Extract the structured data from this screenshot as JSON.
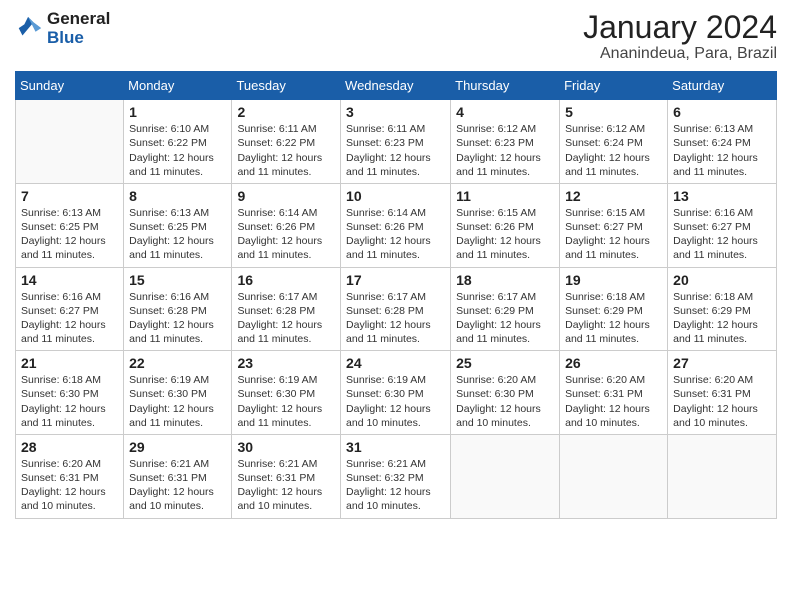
{
  "header": {
    "logo_line1": "General",
    "logo_line2": "Blue",
    "month": "January 2024",
    "location": "Ananindeua, Para, Brazil"
  },
  "weekdays": [
    "Sunday",
    "Monday",
    "Tuesday",
    "Wednesday",
    "Thursday",
    "Friday",
    "Saturday"
  ],
  "weeks": [
    [
      {
        "day": "",
        "sunrise": "",
        "sunset": "",
        "daylight": ""
      },
      {
        "day": "1",
        "sunrise": "Sunrise: 6:10 AM",
        "sunset": "Sunset: 6:22 PM",
        "daylight": "Daylight: 12 hours and 11 minutes."
      },
      {
        "day": "2",
        "sunrise": "Sunrise: 6:11 AM",
        "sunset": "Sunset: 6:22 PM",
        "daylight": "Daylight: 12 hours and 11 minutes."
      },
      {
        "day": "3",
        "sunrise": "Sunrise: 6:11 AM",
        "sunset": "Sunset: 6:23 PM",
        "daylight": "Daylight: 12 hours and 11 minutes."
      },
      {
        "day": "4",
        "sunrise": "Sunrise: 6:12 AM",
        "sunset": "Sunset: 6:23 PM",
        "daylight": "Daylight: 12 hours and 11 minutes."
      },
      {
        "day": "5",
        "sunrise": "Sunrise: 6:12 AM",
        "sunset": "Sunset: 6:24 PM",
        "daylight": "Daylight: 12 hours and 11 minutes."
      },
      {
        "day": "6",
        "sunrise": "Sunrise: 6:13 AM",
        "sunset": "Sunset: 6:24 PM",
        "daylight": "Daylight: 12 hours and 11 minutes."
      }
    ],
    [
      {
        "day": "7",
        "sunrise": "Sunrise: 6:13 AM",
        "sunset": "Sunset: 6:25 PM",
        "daylight": "Daylight: 12 hours and 11 minutes."
      },
      {
        "day": "8",
        "sunrise": "Sunrise: 6:13 AM",
        "sunset": "Sunset: 6:25 PM",
        "daylight": "Daylight: 12 hours and 11 minutes."
      },
      {
        "day": "9",
        "sunrise": "Sunrise: 6:14 AM",
        "sunset": "Sunset: 6:26 PM",
        "daylight": "Daylight: 12 hours and 11 minutes."
      },
      {
        "day": "10",
        "sunrise": "Sunrise: 6:14 AM",
        "sunset": "Sunset: 6:26 PM",
        "daylight": "Daylight: 12 hours and 11 minutes."
      },
      {
        "day": "11",
        "sunrise": "Sunrise: 6:15 AM",
        "sunset": "Sunset: 6:26 PM",
        "daylight": "Daylight: 12 hours and 11 minutes."
      },
      {
        "day": "12",
        "sunrise": "Sunrise: 6:15 AM",
        "sunset": "Sunset: 6:27 PM",
        "daylight": "Daylight: 12 hours and 11 minutes."
      },
      {
        "day": "13",
        "sunrise": "Sunrise: 6:16 AM",
        "sunset": "Sunset: 6:27 PM",
        "daylight": "Daylight: 12 hours and 11 minutes."
      }
    ],
    [
      {
        "day": "14",
        "sunrise": "Sunrise: 6:16 AM",
        "sunset": "Sunset: 6:27 PM",
        "daylight": "Daylight: 12 hours and 11 minutes."
      },
      {
        "day": "15",
        "sunrise": "Sunrise: 6:16 AM",
        "sunset": "Sunset: 6:28 PM",
        "daylight": "Daylight: 12 hours and 11 minutes."
      },
      {
        "day": "16",
        "sunrise": "Sunrise: 6:17 AM",
        "sunset": "Sunset: 6:28 PM",
        "daylight": "Daylight: 12 hours and 11 minutes."
      },
      {
        "day": "17",
        "sunrise": "Sunrise: 6:17 AM",
        "sunset": "Sunset: 6:28 PM",
        "daylight": "Daylight: 12 hours and 11 minutes."
      },
      {
        "day": "18",
        "sunrise": "Sunrise: 6:17 AM",
        "sunset": "Sunset: 6:29 PM",
        "daylight": "Daylight: 12 hours and 11 minutes."
      },
      {
        "day": "19",
        "sunrise": "Sunrise: 6:18 AM",
        "sunset": "Sunset: 6:29 PM",
        "daylight": "Daylight: 12 hours and 11 minutes."
      },
      {
        "day": "20",
        "sunrise": "Sunrise: 6:18 AM",
        "sunset": "Sunset: 6:29 PM",
        "daylight": "Daylight: 12 hours and 11 minutes."
      }
    ],
    [
      {
        "day": "21",
        "sunrise": "Sunrise: 6:18 AM",
        "sunset": "Sunset: 6:30 PM",
        "daylight": "Daylight: 12 hours and 11 minutes."
      },
      {
        "day": "22",
        "sunrise": "Sunrise: 6:19 AM",
        "sunset": "Sunset: 6:30 PM",
        "daylight": "Daylight: 12 hours and 11 minutes."
      },
      {
        "day": "23",
        "sunrise": "Sunrise: 6:19 AM",
        "sunset": "Sunset: 6:30 PM",
        "daylight": "Daylight: 12 hours and 11 minutes."
      },
      {
        "day": "24",
        "sunrise": "Sunrise: 6:19 AM",
        "sunset": "Sunset: 6:30 PM",
        "daylight": "Daylight: 12 hours and 10 minutes."
      },
      {
        "day": "25",
        "sunrise": "Sunrise: 6:20 AM",
        "sunset": "Sunset: 6:30 PM",
        "daylight": "Daylight: 12 hours and 10 minutes."
      },
      {
        "day": "26",
        "sunrise": "Sunrise: 6:20 AM",
        "sunset": "Sunset: 6:31 PM",
        "daylight": "Daylight: 12 hours and 10 minutes."
      },
      {
        "day": "27",
        "sunrise": "Sunrise: 6:20 AM",
        "sunset": "Sunset: 6:31 PM",
        "daylight": "Daylight: 12 hours and 10 minutes."
      }
    ],
    [
      {
        "day": "28",
        "sunrise": "Sunrise: 6:20 AM",
        "sunset": "Sunset: 6:31 PM",
        "daylight": "Daylight: 12 hours and 10 minutes."
      },
      {
        "day": "29",
        "sunrise": "Sunrise: 6:21 AM",
        "sunset": "Sunset: 6:31 PM",
        "daylight": "Daylight: 12 hours and 10 minutes."
      },
      {
        "day": "30",
        "sunrise": "Sunrise: 6:21 AM",
        "sunset": "Sunset: 6:31 PM",
        "daylight": "Daylight: 12 hours and 10 minutes."
      },
      {
        "day": "31",
        "sunrise": "Sunrise: 6:21 AM",
        "sunset": "Sunset: 6:32 PM",
        "daylight": "Daylight: 12 hours and 10 minutes."
      },
      {
        "day": "",
        "sunrise": "",
        "sunset": "",
        "daylight": ""
      },
      {
        "day": "",
        "sunrise": "",
        "sunset": "",
        "daylight": ""
      },
      {
        "day": "",
        "sunrise": "",
        "sunset": "",
        "daylight": ""
      }
    ]
  ]
}
